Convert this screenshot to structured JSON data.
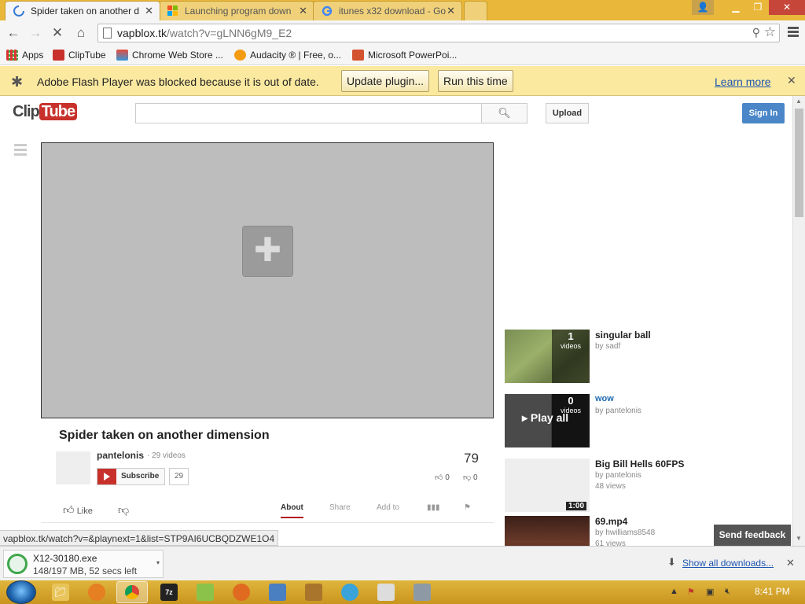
{
  "browser": {
    "tabs": [
      {
        "title": "Spider taken on another d",
        "active": true
      },
      {
        "title": "Launching program down",
        "active": false
      },
      {
        "title": "itunes x32 download - Go",
        "active": false
      }
    ],
    "address": {
      "host": "vapblox.tk",
      "path": "/watch?v=gLNN6gM9_E2"
    },
    "bookmarks": [
      {
        "label": "Apps",
        "icon": "apps-grid-icon"
      },
      {
        "label": "ClipTube",
        "icon": "cliptube-icon"
      },
      {
        "label": "Chrome Web Store ...",
        "icon": "webstore-icon"
      },
      {
        "label": "Audacity ® | Free, o...",
        "icon": "audacity-icon"
      },
      {
        "label": "Microsoft PowerPoi...",
        "icon": "powerpoint-icon"
      }
    ],
    "infobar": {
      "message": "Adobe Flash Player was blocked because it is out of date.",
      "update_label": "Update plugin...",
      "run_label": "Run this time",
      "learn_label": "Learn more"
    },
    "status_url": "vapblox.tk/watch?v=&playnext=1&list=STP9AI6UCBQDZWE1O4"
  },
  "site": {
    "logo_left": "Clip",
    "logo_right": "Tube",
    "upload_label": "Upload",
    "signin_label": "Sign In"
  },
  "video": {
    "title": "Spider taken on another dimension",
    "owner": "pantelonis",
    "owner_videos": "· 29 videos",
    "subscribe_label": "Subscribe",
    "subscriber_count": "29",
    "views": "79",
    "likes": "0",
    "dislikes": "0",
    "like_label": "Like",
    "tabs": [
      "About",
      "Share",
      "Add to"
    ]
  },
  "playlist": [
    {
      "title": "singular ball",
      "by": "by sadf",
      "count": "1",
      "count_label": "videos"
    },
    {
      "title": "wow",
      "by": "by pantelonis",
      "count": "0",
      "count_label": "videos",
      "overlay": "Play all"
    },
    {
      "title": "Big Bill Hells 60FPS",
      "by": "by pantelonis",
      "meta": "48 views",
      "duration": "1:00"
    },
    {
      "title": "69.mp4",
      "by": "by hwilliams8548",
      "meta": "61 views"
    }
  ],
  "feedback_label": "Send feedback",
  "downloads": {
    "file": "X12-30180.exe",
    "progress": "148/197 MB, 52 secs left",
    "show_all_label": "Show all downloads..."
  },
  "taskbar": {
    "clock": "8:41 PM"
  },
  "colors": {
    "accent": "#c8312b",
    "link": "#1c55b0",
    "signin": "#4a86c8"
  }
}
